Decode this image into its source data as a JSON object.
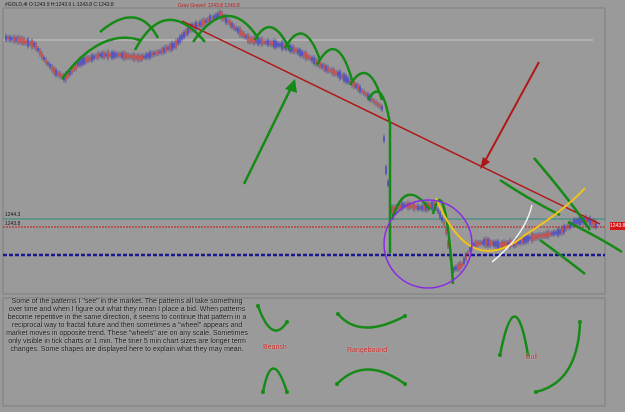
{
  "header": {
    "instrument": "#GOLD,4I O:1243.9 H:1243.9 L:1243.8 C:1243.8",
    "overlay_label": "Gray Gravel: 1243.8 1243.8"
  },
  "price_axis": {
    "level_upper": "1244.3",
    "level_lower": "1243.8",
    "current_price": "1243.8"
  },
  "annotations": {
    "note": "Some of the patterns I \"see\" in the market. The patterns all take something over time and when I figure out what they mean I place a bid. When patterns become repetitive in the same direction, it seems to continue that pattern in a reciprocal way to fractal future and then sometimes a \"wheel\" appears and market moves in opposite trend. These \"wheels\" are on any scale. Sometimes only visible in tick charts or 1 min. The tiner 5 min chart sizes are longer term changes. Some shapes are displayed here to explain what they may mean.",
    "bearish_label": "Bearish",
    "rangebound_label": "Rangebound",
    "bull_label": "Bull"
  },
  "colors": {
    "background": "#9a9a9a",
    "trendline": "#b01818",
    "pattern": "#168a16",
    "yellow_arc": "#f2c21a",
    "purple_circle": "#8a2be2",
    "support_dash": "#1a1a8c"
  }
}
